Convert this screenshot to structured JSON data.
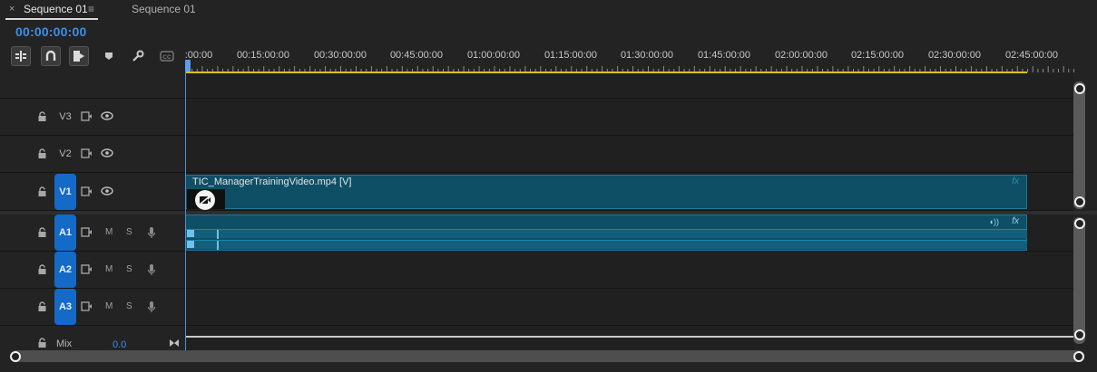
{
  "tabs": [
    {
      "label": "Sequence 01",
      "active": true,
      "close_glyph": "×",
      "menu_glyph": "≡"
    },
    {
      "label": "Sequence 01",
      "active": false
    }
  ],
  "timecode": "00:00:00:00",
  "toolbar": [
    {
      "name": "insert-overwrite-icon",
      "boxed": true
    },
    {
      "name": "snap-icon",
      "boxed": true
    },
    {
      "name": "linked-selection-icon",
      "boxed": true
    },
    {
      "name": "add-marker-icon",
      "boxed": false
    },
    {
      "name": "wrench-icon",
      "boxed": false
    },
    {
      "name": "captions-icon",
      "boxed": false
    }
  ],
  "ruler": {
    "labels": [
      ":00:00",
      "00:15:00:00",
      "00:30:00:00",
      "00:45:00:00",
      "01:00:00:00",
      "01:15:00:00",
      "01:30:00:00",
      "01:45:00:00",
      "02:00:00:00",
      "02:15:00:00",
      "02:30:00:00",
      "02:45:00:00"
    ]
  },
  "video_tracks": [
    {
      "name": "V3",
      "targeted": false
    },
    {
      "name": "V2",
      "targeted": false
    },
    {
      "name": "V1",
      "targeted": true
    }
  ],
  "audio_tracks": [
    {
      "name": "A1",
      "mute": "M",
      "solo": "S"
    },
    {
      "name": "A2",
      "mute": "M",
      "solo": "S"
    },
    {
      "name": "A3",
      "mute": "M",
      "solo": "S"
    }
  ],
  "mix": {
    "label": "Mix",
    "value": "0.0"
  },
  "clips": {
    "video": {
      "name": "TIC_ManagerTrainingVideo.mp4 [V]",
      "fx": "fx"
    },
    "audio": {
      "fx": "fx"
    }
  },
  "colors": {
    "accent": "#1569c7",
    "timecode": "#3d8ee8",
    "clip": "#0f4f66",
    "work_area": "#d8c21e"
  }
}
